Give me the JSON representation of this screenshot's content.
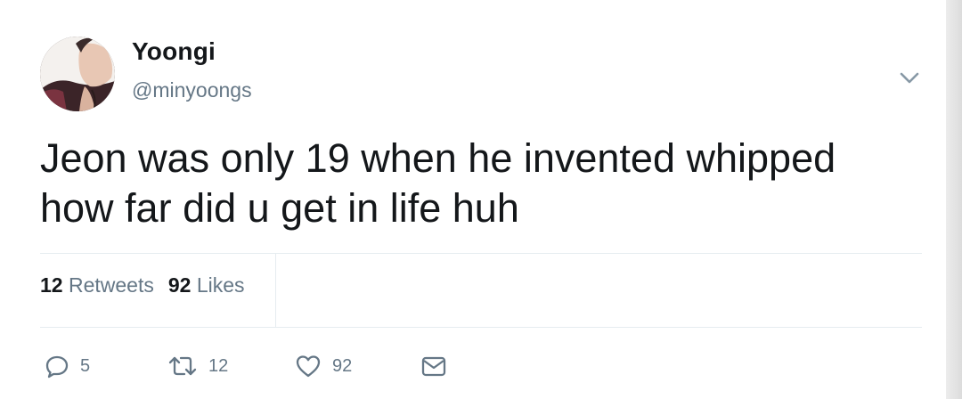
{
  "user": {
    "display_name": "Yoongi",
    "handle": "@minyoongs"
  },
  "tweet": {
    "lines": [
      "Jeon was only 19 when he invented whipped",
      "how far did u get in life huh"
    ]
  },
  "stats": {
    "retweets_count": "12",
    "retweets_label": "Retweets",
    "likes_count": "92",
    "likes_label": "Likes"
  },
  "actions": {
    "reply_count": "5",
    "retweet_count": "12",
    "like_count": "92"
  },
  "icons": {
    "caret": "chevron-down-icon",
    "reply": "reply-icon",
    "retweet": "retweet-icon",
    "like": "heart-icon",
    "message": "envelope-icon"
  },
  "colors": {
    "text": "#14171a",
    "secondary": "#657786",
    "divider": "#e6ecf0"
  }
}
